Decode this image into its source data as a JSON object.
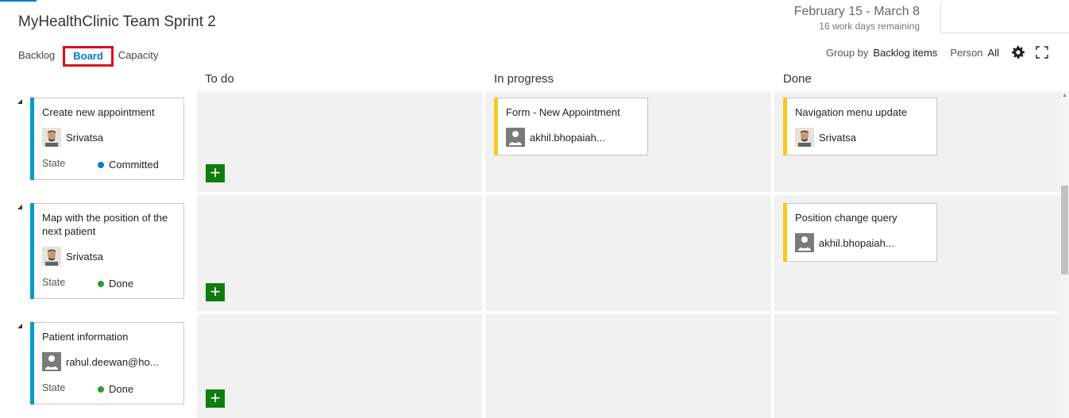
{
  "header": {
    "title": "MyHealthClinic Team Sprint 2",
    "sprint_dates": "February 15 - March 8",
    "sprint_remaining": "16 work days remaining"
  },
  "tabs": [
    {
      "label": "Backlog",
      "active": false
    },
    {
      "label": "Board",
      "active": true
    },
    {
      "label": "Capacity",
      "active": false
    }
  ],
  "toolbar": {
    "group_by_label": "Group by",
    "group_by_value": "Backlog items",
    "person_label": "Person",
    "person_value": "All"
  },
  "columns": [
    "To do",
    "In progress",
    "Done"
  ],
  "rows": [
    {
      "backlog_item": {
        "title": "Create new appointment",
        "assignee": "Srivatsa",
        "state_label": "State",
        "state": "Committed",
        "state_color": "#007acc"
      },
      "in_progress": [
        {
          "title": "Form - New Appointment",
          "assignee": "akhil.bhopaiah..."
        }
      ],
      "done": [
        {
          "title": "Navigation menu update",
          "assignee": "Srivatsa"
        }
      ]
    },
    {
      "backlog_item": {
        "title": "Map with the position of the next patient",
        "assignee": "Srivatsa",
        "state_label": "State",
        "state": "Done",
        "state_color": "#339933"
      },
      "in_progress": [],
      "done": [
        {
          "title": "Position change query",
          "assignee": "akhil.bhopaiah..."
        }
      ]
    },
    {
      "backlog_item": {
        "title": "Patient information",
        "assignee": "rahul.deewan@ho...",
        "state_label": "State",
        "state": "Done",
        "state_color": "#339933"
      },
      "in_progress": [],
      "done": []
    }
  ],
  "colors": {
    "accent": "#0078d7",
    "highlight_box": "#e00b1c",
    "backlog_card_bar": "#009ccc",
    "task_card_bar": "#f2cb1d",
    "add_button": "#107c10",
    "cell_background": "#f1f1f1"
  }
}
